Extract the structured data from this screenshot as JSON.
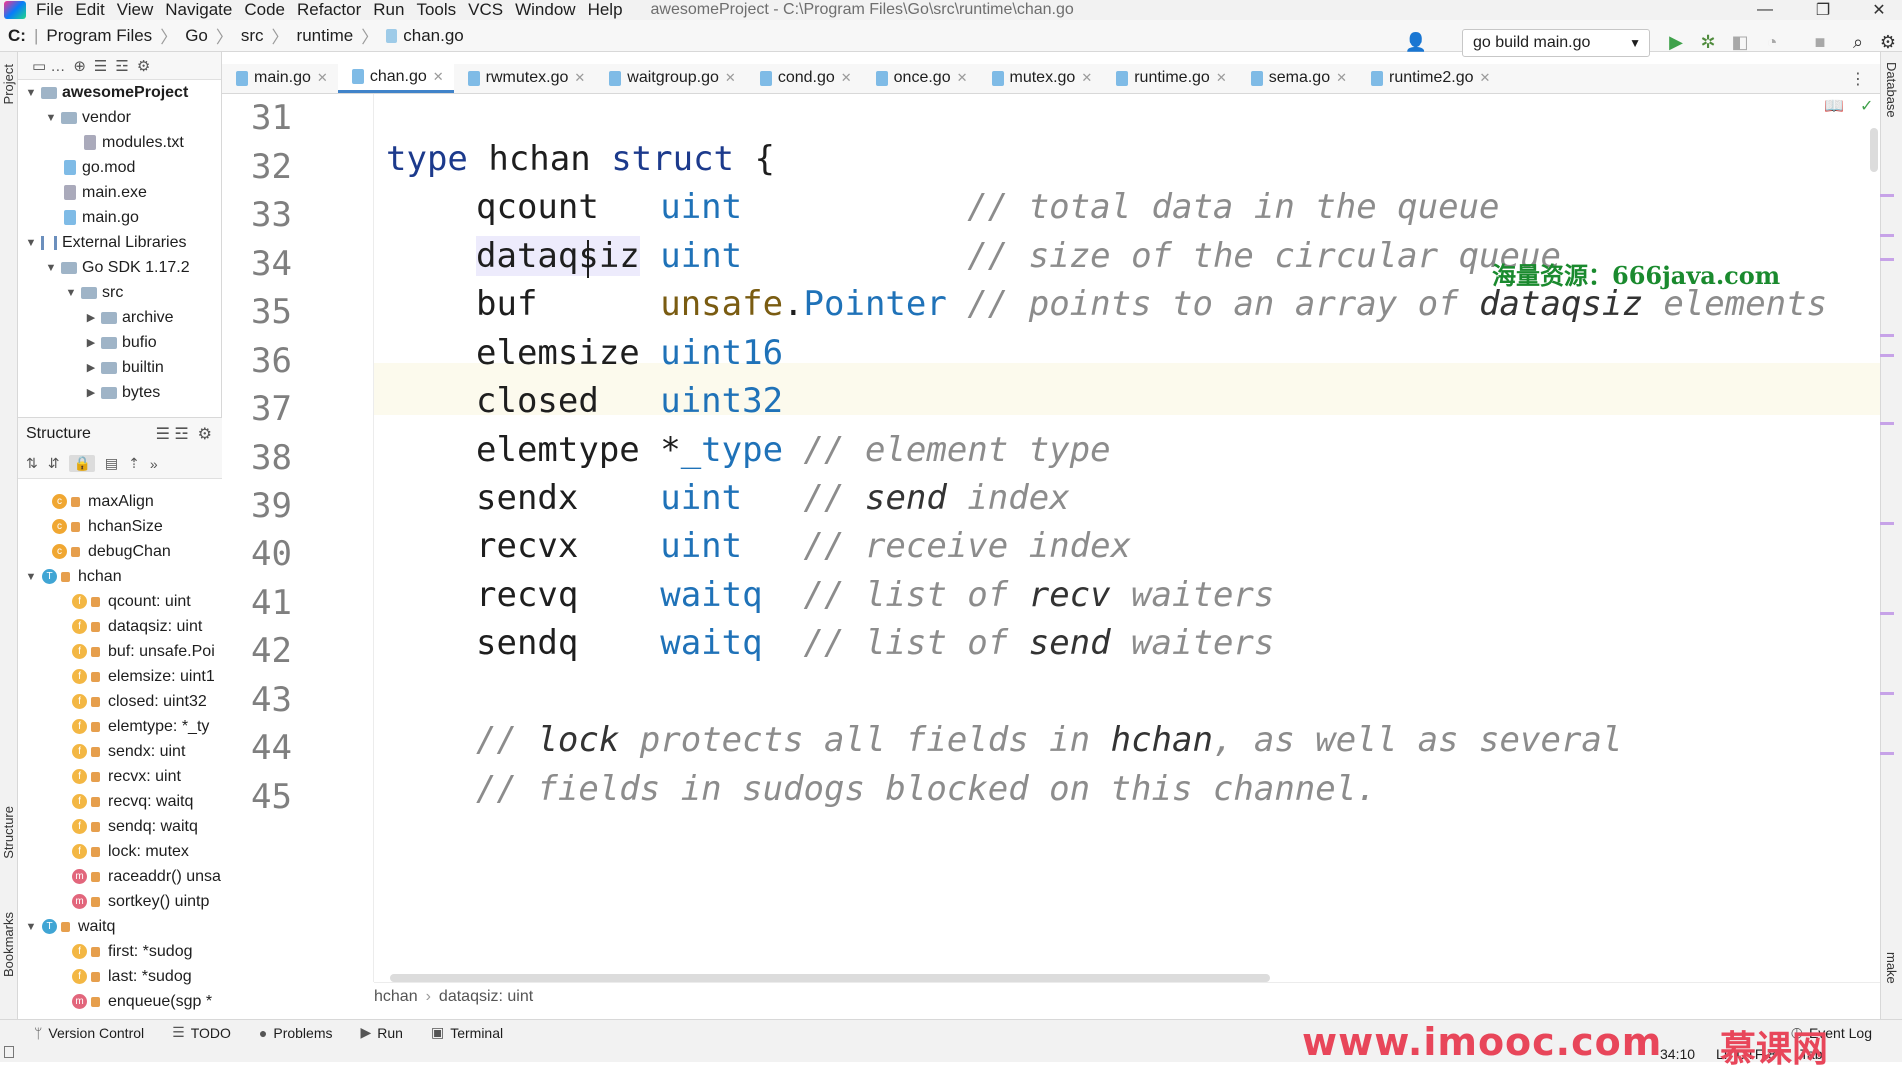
{
  "menubar": {
    "items": [
      "File",
      "Edit",
      "View",
      "Navigate",
      "Code",
      "Refactor",
      "Run",
      "Tools",
      "VCS",
      "Window",
      "Help"
    ],
    "title": "awesomeProject - C:\\Program Files\\Go\\src\\runtime\\chan.go"
  },
  "navbar": {
    "drive": "C:",
    "crumbs": [
      "Program Files",
      "Go",
      "src",
      "runtime",
      "chan.go"
    ],
    "run_config": "go build main.go"
  },
  "side_labels": {
    "project": "Project",
    "structure": "Structure",
    "bookmarks": "Bookmarks",
    "database": "Database",
    "make": "make"
  },
  "project_tree": [
    {
      "label": "awesomeProject",
      "type": "root"
    },
    {
      "label": "vendor",
      "type": "folder"
    },
    {
      "label": "modules.txt",
      "type": "txt"
    },
    {
      "label": "go.mod",
      "type": "go"
    },
    {
      "label": "main.exe",
      "type": "exe"
    },
    {
      "label": "main.go",
      "type": "go"
    },
    {
      "label": "External Libraries",
      "type": "lib"
    },
    {
      "label": "Go SDK 1.17.2",
      "type": "folder"
    },
    {
      "label": "src",
      "type": "folder"
    },
    {
      "label": "archive",
      "type": "folder"
    },
    {
      "label": "bufio",
      "type": "folder"
    },
    {
      "label": "builtin",
      "type": "folder"
    },
    {
      "label": "bytes",
      "type": "folder"
    }
  ],
  "structure": {
    "title": "Structure",
    "items": [
      {
        "badge": "c",
        "label": "maxAlign"
      },
      {
        "badge": "c",
        "label": "hchanSize"
      },
      {
        "badge": "c",
        "label": "debugChan"
      },
      {
        "badge": "t",
        "label": "hchan"
      },
      {
        "badge": "f",
        "label": "qcount: uint"
      },
      {
        "badge": "f",
        "label": "dataqsiz: uint"
      },
      {
        "badge": "f",
        "label": "buf: unsafe.Poi"
      },
      {
        "badge": "f",
        "label": "elemsize: uint1"
      },
      {
        "badge": "f",
        "label": "closed: uint32"
      },
      {
        "badge": "f",
        "label": "elemtype: *_ty"
      },
      {
        "badge": "f",
        "label": "sendx: uint"
      },
      {
        "badge": "f",
        "label": "recvx: uint"
      },
      {
        "badge": "f",
        "label": "recvq: waitq"
      },
      {
        "badge": "f",
        "label": "sendq: waitq"
      },
      {
        "badge": "f",
        "label": "lock: mutex"
      },
      {
        "badge": "m",
        "label": "raceaddr() unsa"
      },
      {
        "badge": "m",
        "label": "sortkey() uintp"
      },
      {
        "badge": "t",
        "label": "waitq"
      },
      {
        "badge": "f",
        "label": "first: *sudog"
      },
      {
        "badge": "f",
        "label": "last: *sudog"
      },
      {
        "badge": "m",
        "label": "enqueue(sgp *"
      }
    ]
  },
  "tabs": [
    "main.go",
    "chan.go",
    "rwmutex.go",
    "waitgroup.go",
    "cond.go",
    "once.go",
    "mutex.go",
    "runtime.go",
    "sema.go",
    "runtime2.go"
  ],
  "active_tab": "chan.go",
  "editor": {
    "line_numbers": [
      "31",
      "32",
      "33",
      "34",
      "35",
      "36",
      "37",
      "38",
      "39",
      "40",
      "41",
      "42",
      "43",
      "44",
      "45"
    ]
  },
  "watermark_top": "海量资源：666java.com",
  "breadcrumb": [
    "hchan",
    "dataqsiz: uint"
  ],
  "toolwindows": [
    "Version Control",
    "TODO",
    "Problems",
    "Run",
    "Terminal"
  ],
  "event_log": "Event Log",
  "status": {
    "position": "34:10",
    "encoding": "LF  UTF-8",
    "indent": "Tab"
  },
  "watermark_bottom": "www.imooc.com",
  "watermark_brand": "慕课网",
  "colors": {
    "keyword": "#1c3a8c",
    "type": "#1f72b8",
    "comment": "#8c8c8c",
    "accent": "#4083c9"
  }
}
